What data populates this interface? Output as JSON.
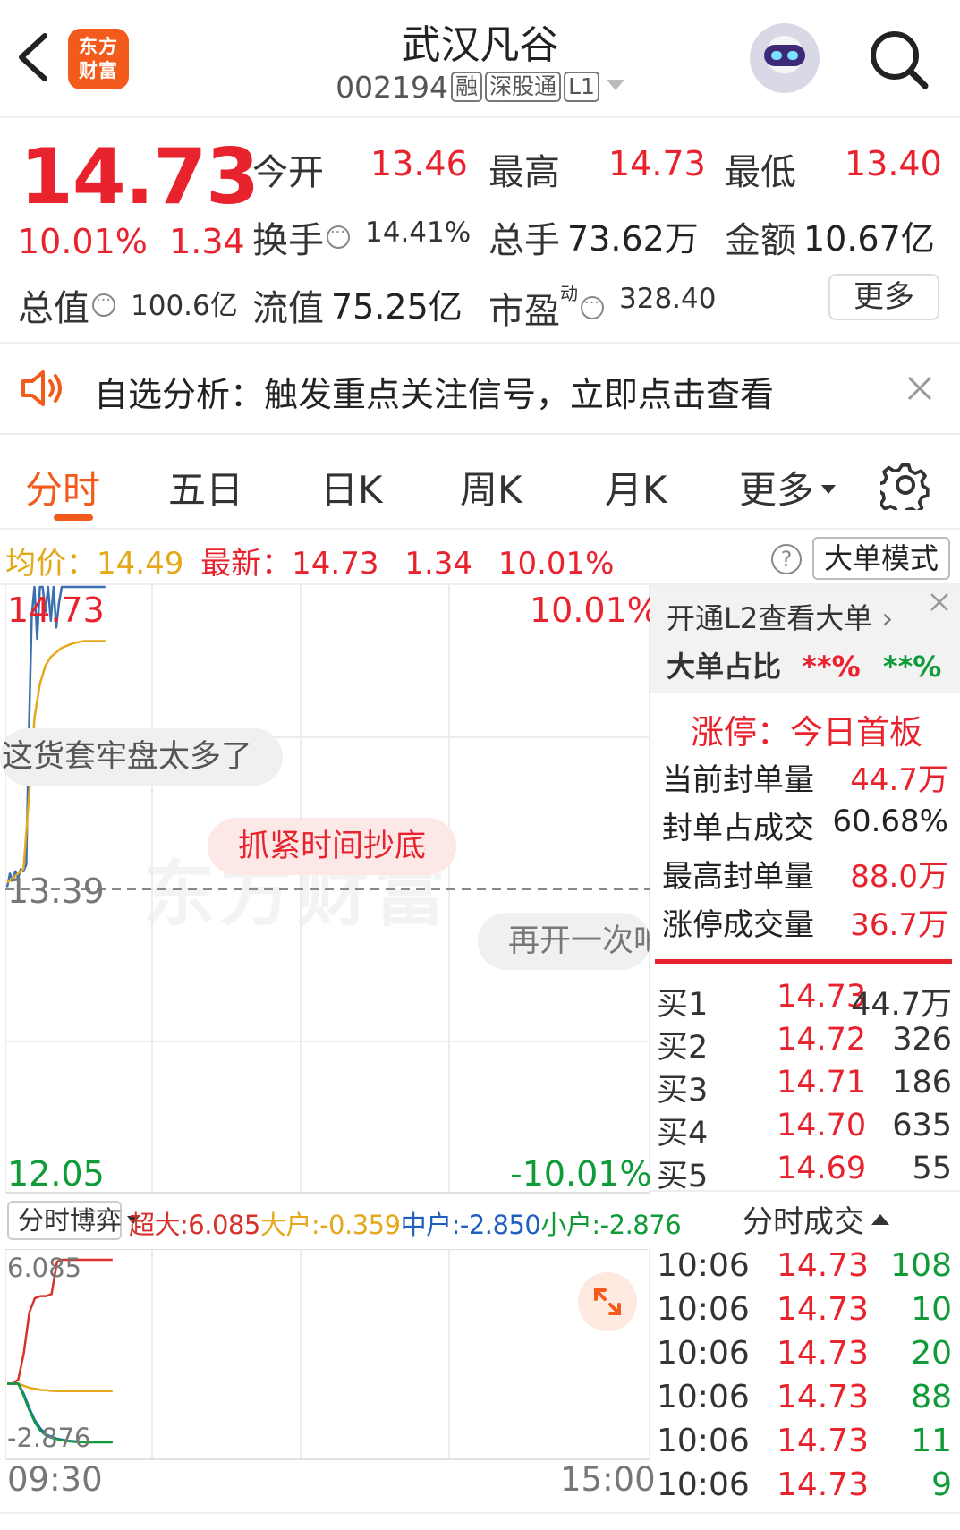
{
  "header": {
    "logo_line1": "东方",
    "logo_line2": "财富",
    "title": "武汉凡谷",
    "code": "002194",
    "tags": [
      "融",
      "深股通",
      "L1"
    ]
  },
  "quote": {
    "price": "14.73",
    "change_pct": "10.01%",
    "change_abs": "1.34",
    "open_label": "今开",
    "open_val": "13.46",
    "high_label": "最高",
    "high_val": "14.73",
    "low_label": "最低",
    "low_val": "13.40",
    "turnover_label": "换手",
    "turnover_val": "14.41%",
    "volume_label": "总手",
    "volume_val": "73.62万",
    "amount_label": "金额",
    "amount_val": "10.67亿",
    "mktcap_label": "总值",
    "mktcap_val": "100.6亿",
    "float_label": "流值",
    "float_val": "75.25亿",
    "pe_label": "市盈",
    "pe_sup": "动",
    "pe_val": "328.40",
    "more_label": "更多"
  },
  "notice": {
    "text": "自选分析：触发重点关注信号，立即点击查看"
  },
  "tabs": [
    "分时",
    "五日",
    "日K",
    "周K",
    "月K",
    "更多"
  ],
  "info_row": {
    "avg_label": "均价：",
    "avg_val": "14.49",
    "latest_label": "最新：",
    "latest_price": "14.73",
    "latest_chg": "1.34",
    "latest_pct": "10.01%",
    "help": "?",
    "big_mode": "大单模式"
  },
  "chart": {
    "y_top": "14.73",
    "y_mid": "13.39",
    "y_bottom": "12.05",
    "pct_top": "10.01%",
    "pct_bottom": "-10.01%",
    "watermark": "东方财富",
    "time_start": "09:30",
    "time_end": "15:00",
    "bubbles": [
      "这货套牢盘太多了",
      "抓紧时间抄底",
      "再开一次吧"
    ]
  },
  "chart_data": {
    "type": "line",
    "ylim": [
      12.05,
      14.73
    ],
    "reference": 13.39,
    "series": [
      {
        "name": "",
        "color": "#3a6fb0",
        "x": [
          0,
          1,
          2,
          3,
          4,
          5,
          6,
          7,
          8,
          9,
          10,
          11,
          12,
          13,
          14,
          15,
          16,
          17,
          18,
          19,
          20,
          21,
          22,
          23,
          24,
          25,
          26,
          27,
          28,
          29,
          30,
          31,
          32,
          33,
          34,
          35,
          36
        ],
        "values": [
          13.4,
          13.46,
          13.43,
          13.47,
          13.44,
          13.48,
          13.47,
          13.5,
          14.1,
          14.6,
          14.73,
          14.5,
          14.73,
          14.73,
          14.62,
          14.73,
          14.58,
          14.73,
          14.55,
          14.66,
          14.73,
          14.73,
          14.73,
          14.73,
          14.73,
          14.73,
          14.73,
          14.73,
          14.73,
          14.73,
          14.73,
          14.73,
          14.73,
          14.73,
          14.73,
          14.73,
          14.73
        ]
      },
      {
        "name": "",
        "color": "#e3a91b",
        "x": [
          0,
          2,
          4,
          6,
          8,
          10,
          12,
          14,
          16,
          18,
          20,
          24,
          28,
          32,
          36
        ],
        "values": [
          13.42,
          13.44,
          13.46,
          13.48,
          13.8,
          14.15,
          14.3,
          14.38,
          14.42,
          14.44,
          14.46,
          14.48,
          14.49,
          14.49,
          14.49
        ]
      }
    ]
  },
  "game": {
    "button": "分时博弈",
    "super_label": "超大:",
    "super_val": "6.085",
    "big_label": "大户:",
    "big_val": "-0.359",
    "mid_label": "中户:",
    "mid_val": "-2.850",
    "small_label": "小户:",
    "small_val": "-2.876",
    "y_top": "6.085",
    "y_bottom": "-2.876"
  },
  "game_data": {
    "type": "line",
    "ylim": [
      -2.876,
      6.085
    ],
    "series": [
      {
        "name": "超大",
        "color": "#d6312b",
        "values": [
          0,
          0,
          0.2,
          1.5,
          3.5,
          4.2,
          4.3,
          4.3,
          4.4,
          6.0,
          6.085,
          6.085,
          6.085,
          6.085,
          6.085,
          6.085,
          6.085,
          6.085,
          6.085,
          6.085
        ]
      },
      {
        "name": "大户",
        "color": "#e3a91b",
        "values": [
          0,
          0,
          0,
          -0.1,
          -0.2,
          -0.25,
          -0.3,
          -0.32,
          -0.35,
          -0.36,
          -0.36,
          -0.36,
          -0.36,
          -0.36,
          -0.36,
          -0.36,
          -0.36,
          -0.359,
          -0.359,
          -0.359
        ]
      },
      {
        "name": "中户",
        "color": "#1f5fbf",
        "values": [
          0,
          0,
          0,
          -0.5,
          -1.2,
          -1.8,
          -2.2,
          -2.5,
          -2.6,
          -2.7,
          -2.75,
          -2.8,
          -2.82,
          -2.84,
          -2.85,
          -2.85,
          -2.85,
          -2.85,
          -2.85,
          -2.85
        ]
      },
      {
        "name": "小户",
        "color": "#0f9b38",
        "values": [
          0,
          0,
          0,
          -0.6,
          -1.3,
          -1.9,
          -2.3,
          -2.55,
          -2.65,
          -2.72,
          -2.78,
          -2.82,
          -2.85,
          -2.86,
          -2.87,
          -2.876,
          -2.876,
          -2.876,
          -2.876,
          -2.876
        ]
      }
    ]
  },
  "l2": {
    "open_text": "开通L2查看大单",
    "ratio_label": "大单占比",
    "ratio_buy": "**%",
    "ratio_sell": "**%"
  },
  "limit_up": {
    "title": "涨停：今日首板",
    "rows": [
      {
        "label": "当前封单量",
        "value": "44.7万"
      },
      {
        "label": "封单占成交",
        "value": "60.68%"
      },
      {
        "label": "最高封单量",
        "value": "88.0万"
      },
      {
        "label": "涨停成交量",
        "value": "36.7万"
      }
    ]
  },
  "order_book": [
    {
      "label": "买1",
      "price": "14.73",
      "vol": "44.7万"
    },
    {
      "label": "买2",
      "price": "14.72",
      "vol": "326"
    },
    {
      "label": "买3",
      "price": "14.71",
      "vol": "186"
    },
    {
      "label": "买4",
      "price": "14.70",
      "vol": "635"
    },
    {
      "label": "买5",
      "price": "14.69",
      "vol": "55"
    }
  ],
  "ticks": {
    "title": "分时成交",
    "rows": [
      {
        "time": "10:06",
        "price": "14.73",
        "vol": "108"
      },
      {
        "time": "10:06",
        "price": "14.73",
        "vol": "10"
      },
      {
        "time": "10:06",
        "price": "14.73",
        "vol": "20"
      },
      {
        "time": "10:06",
        "price": "14.73",
        "vol": "88"
      },
      {
        "time": "10:06",
        "price": "14.73",
        "vol": "11"
      },
      {
        "time": "10:06",
        "price": "14.73",
        "vol": "9"
      }
    ]
  },
  "colors": {
    "up": "#e8232e",
    "down": "#0f9b38",
    "accent": "#f35b1d",
    "avg": "#e3a91b",
    "price_line": "#3a6fb0"
  }
}
